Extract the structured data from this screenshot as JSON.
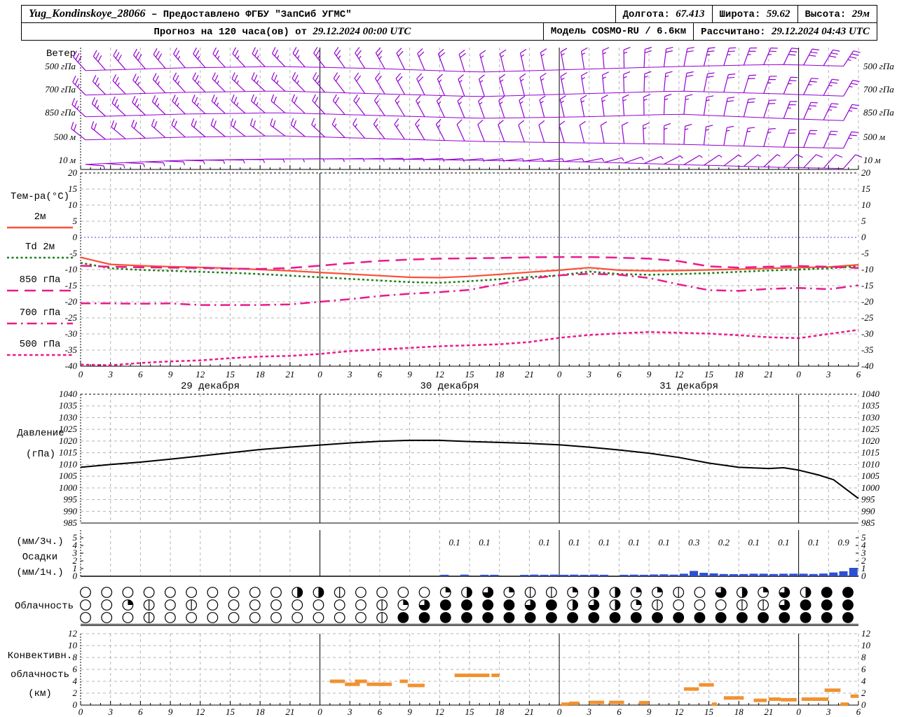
{
  "header": {
    "row1": {
      "station": "Yug_Kondinskoye_28066",
      "provider": "– Предоставлено ФГБУ \"ЗапСиб УГМС\"",
      "lon_label": "Долгота:",
      "lon_value": "67.413",
      "lat_label": "Широта:",
      "lat_value": "59.62",
      "alt_label": "Высота:",
      "alt_value": "29м"
    },
    "row2": {
      "forecast_label": "Прогноз на 120 часа(ов) от",
      "forecast_start": "29.12.2024 00:00 UTC",
      "model_label": "Модель",
      "model_value": "COSMO-RU / 6.6км",
      "calc_label": "Рассчитано:",
      "calc_value": "29.12.2024 04:43 UTC"
    }
  },
  "axes": {
    "hours": [
      0,
      3,
      6,
      9,
      12,
      15,
      18,
      21,
      24,
      27,
      30,
      33,
      36,
      39,
      42,
      45,
      48,
      51,
      54,
      57,
      60,
      63,
      66,
      69,
      72,
      75,
      78
    ],
    "date_labels": [
      {
        "hour": 13,
        "text": "29 декабря"
      },
      {
        "hour": 37,
        "text": "30 декабря"
      },
      {
        "hour": 61,
        "text": "31 декабря"
      }
    ]
  },
  "chart_data": [
    {
      "id": "wind",
      "type": "wind-barbs",
      "title": "Ветер",
      "color": "#9400d3",
      "control_hours": [
        0,
        10,
        20,
        30,
        40,
        50,
        60,
        70,
        78
      ],
      "rows": [
        {
          "label": "500 гПа",
          "dir": [
            318,
            320,
            315,
            330,
            345,
            350,
            370,
            385,
            395
          ],
          "spd": [
            30,
            30,
            28,
            25,
            20,
            18,
            22,
            30,
            35
          ],
          "dy": [
            6,
            2,
            0,
            3,
            8,
            4,
            0,
            -3,
            0
          ]
        },
        {
          "label": "700 гПа",
          "dir": [
            315,
            318,
            312,
            328,
            342,
            350,
            368,
            382,
            392
          ],
          "spd": [
            28,
            28,
            26,
            22,
            18,
            16,
            20,
            26,
            30
          ],
          "dy": [
            8,
            4,
            2,
            6,
            10,
            6,
            2,
            6,
            10
          ]
        },
        {
          "label": "850 гПа",
          "dir": [
            312,
            315,
            310,
            325,
            340,
            348,
            365,
            380,
            390
          ],
          "spd": [
            25,
            26,
            24,
            20,
            15,
            14,
            18,
            24,
            28
          ],
          "dy": [
            6,
            2,
            0,
            4,
            8,
            6,
            2,
            8,
            12
          ]
        },
        {
          "label": "500 м",
          "dir": [
            308,
            312,
            306,
            322,
            338,
            345,
            363,
            378,
            388
          ],
          "spd": [
            22,
            23,
            21,
            18,
            12,
            12,
            16,
            20,
            25
          ],
          "dy": [
            4,
            0,
            -2,
            2,
            6,
            8,
            10,
            14,
            16
          ]
        },
        {
          "label": "10 м",
          "dir": [
            95,
            92,
            90,
            88,
            85,
            80,
            60,
            45,
            40
          ],
          "spd": [
            8,
            9,
            9,
            8,
            7,
            6,
            8,
            10,
            12
          ],
          "dy": [
            6,
            0,
            -2,
            -2,
            0,
            2,
            6,
            10,
            12
          ]
        }
      ]
    },
    {
      "id": "temperature",
      "type": "line",
      "title": "Тем-ра(°C)",
      "ylim": [
        -40,
        20
      ],
      "ytick_step": 5,
      "zero_line_color": "#4040ff",
      "x_step_hours": 3,
      "series": [
        {
          "name": "2м",
          "color": "#fa5038",
          "style": "solid",
          "values": [
            -6.2,
            -8.4,
            -8.8,
            -9.1,
            -9.3,
            -9.6,
            -10.0,
            -10.4,
            -10.9,
            -11.4,
            -11.9,
            -12.4,
            -12.5,
            -12.1,
            -11.5,
            -10.8,
            -10.2,
            -9.4,
            -10.2,
            -10.4,
            -10.3,
            -10.1,
            -9.9,
            -9.6,
            -9.4,
            -9.2,
            -8.5
          ]
        },
        {
          "name": "Td 2м",
          "color": "#177d17",
          "style": "dotted",
          "values": [
            -7.9,
            -9.6,
            -10.1,
            -10.4,
            -10.7,
            -11.0,
            -11.4,
            -11.9,
            -12.4,
            -12.9,
            -13.4,
            -13.9,
            -14.1,
            -13.6,
            -13.0,
            -12.3,
            -11.8,
            -10.6,
            -11.4,
            -11.6,
            -11.4,
            -11.1,
            -10.7,
            -10.3,
            -10.0,
            -9.6,
            -9.0
          ]
        },
        {
          "name": "850 гПа",
          "color": "#ea1a8c",
          "style": "longdash",
          "values": [
            -8.8,
            -9.1,
            -9.3,
            -9.4,
            -9.5,
            -9.7,
            -9.8,
            -9.5,
            -8.8,
            -8.0,
            -7.3,
            -6.9,
            -6.6,
            -6.5,
            -6.4,
            -6.2,
            -6.1,
            -6.1,
            -6.3,
            -6.6,
            -7.4,
            -9.0,
            -9.4,
            -9.1,
            -8.9,
            -9.1,
            -9.5
          ]
        },
        {
          "name": "700 гПа",
          "color": "#ea1a8c",
          "style": "dashdot",
          "values": [
            -20.5,
            -20.5,
            -20.6,
            -20.5,
            -21.0,
            -21.0,
            -21.0,
            -20.8,
            -20.0,
            -19.2,
            -18.2,
            -17.5,
            -17.0,
            -16.3,
            -14.5,
            -12.8,
            -11.8,
            -11.3,
            -11.6,
            -12.6,
            -14.6,
            -16.4,
            -16.6,
            -16.0,
            -15.7,
            -16.1,
            -14.9
          ]
        },
        {
          "name": "500 гПа",
          "color": "#ea1a8c",
          "style": "shortdash",
          "values": [
            -39.5,
            -39.7,
            -39.0,
            -38.5,
            -38.2,
            -37.5,
            -37.0,
            -36.8,
            -36.2,
            -35.3,
            -34.8,
            -34.3,
            -33.8,
            -33.5,
            -33.2,
            -32.5,
            -31.2,
            -30.3,
            -29.8,
            -29.4,
            -29.6,
            -29.9,
            -30.4,
            -31.0,
            -31.3,
            -30.0,
            -28.7
          ]
        }
      ]
    },
    {
      "id": "pressure",
      "type": "line",
      "ylabel_lines": [
        "Давление",
        "(гПа)"
      ],
      "ylim": [
        985,
        1040
      ],
      "ytick_step": 5,
      "color": "#000000",
      "points": [
        [
          0,
          1008.8
        ],
        [
          3,
          1010.0
        ],
        [
          6,
          1011.0
        ],
        [
          9,
          1012.3
        ],
        [
          12,
          1013.6
        ],
        [
          15,
          1015.0
        ],
        [
          18,
          1016.4
        ],
        [
          21,
          1017.4
        ],
        [
          24,
          1018.3
        ],
        [
          27,
          1019.2
        ],
        [
          30,
          1019.9
        ],
        [
          33,
          1020.3
        ],
        [
          36,
          1020.3
        ],
        [
          39,
          1019.8
        ],
        [
          42,
          1019.4
        ],
        [
          45,
          1019.0
        ],
        [
          48,
          1018.4
        ],
        [
          51,
          1017.4
        ],
        [
          54,
          1016.2
        ],
        [
          57,
          1014.8
        ],
        [
          60,
          1013.0
        ],
        [
          63,
          1010.6
        ],
        [
          66,
          1008.8
        ],
        [
          69,
          1008.3
        ],
        [
          70.5,
          1008.6
        ],
        [
          72,
          1007.6
        ],
        [
          74,
          1005.5
        ],
        [
          75.5,
          1003.5
        ],
        [
          78,
          995.5
        ]
      ]
    },
    {
      "id": "precipitation",
      "type": "bar",
      "ylabel_lines": [
        "(мм/3ч.)",
        "Осадки",
        "(мм/1ч.)"
      ],
      "ylim": [
        0,
        5
      ],
      "bar_color": "#2d4fd2",
      "labels_3h": [
        {
          "h": 36,
          "v": "0.1"
        },
        {
          "h": 39,
          "v": "0.1"
        },
        {
          "h": 45,
          "v": "0.1"
        },
        {
          "h": 48,
          "v": "0.1"
        },
        {
          "h": 51,
          "v": "0.1"
        },
        {
          "h": 54,
          "v": "0.1"
        },
        {
          "h": 57,
          "v": "0.1"
        },
        {
          "h": 60,
          "v": "0.3"
        },
        {
          "h": 63,
          "v": "0.2"
        },
        {
          "h": 66,
          "v": "0.1"
        },
        {
          "h": 69,
          "v": "0.1"
        },
        {
          "h": 72,
          "v": "0.1"
        },
        {
          "h": 75,
          "v": "0.9"
        }
      ],
      "bars_1h": [
        [
          36,
          0.05
        ],
        [
          38,
          0.06
        ],
        [
          40,
          0.05
        ],
        [
          41,
          0.05
        ],
        [
          44,
          0.04
        ],
        [
          45,
          0.06
        ],
        [
          46,
          0.05
        ],
        [
          47,
          0.06
        ],
        [
          48,
          0.05
        ],
        [
          49,
          0.06
        ],
        [
          50,
          0.05
        ],
        [
          51,
          0.06
        ],
        [
          52,
          0.05
        ],
        [
          54,
          0.05
        ],
        [
          55,
          0.06
        ],
        [
          56,
          0.05
        ],
        [
          57,
          0.07
        ],
        [
          58,
          0.08
        ],
        [
          59,
          0.06
        ],
        [
          60,
          0.12
        ],
        [
          61,
          0.3
        ],
        [
          62,
          0.18
        ],
        [
          63,
          0.14
        ],
        [
          64,
          0.1
        ],
        [
          65,
          0.09
        ],
        [
          66,
          0.1
        ],
        [
          67,
          0.12
        ],
        [
          68,
          0.12
        ],
        [
          69,
          0.1
        ],
        [
          70,
          0.12
        ],
        [
          71,
          0.12
        ],
        [
          72,
          0.12
        ],
        [
          73,
          0.1
        ],
        [
          74,
          0.13
        ],
        [
          75,
          0.2
        ],
        [
          76,
          0.28
        ],
        [
          77,
          0.5
        ]
      ]
    },
    {
      "id": "cloudiness",
      "type": "cloud-cover",
      "label": "Облачность",
      "octa_rows": [
        [
          0,
          0,
          0,
          0,
          0,
          0,
          0,
          0,
          0,
          0,
          4,
          4,
          1,
          0,
          0,
          0,
          0,
          2,
          4,
          6,
          2,
          1,
          1,
          2,
          4,
          4,
          2,
          2,
          1,
          0,
          6,
          4,
          2,
          6,
          4,
          8,
          8
        ],
        [
          0,
          0,
          2,
          1,
          0,
          1,
          0,
          0,
          0,
          0,
          0,
          0,
          0,
          0,
          1,
          2,
          6,
          8,
          8,
          8,
          8,
          6,
          8,
          4,
          6,
          4,
          2,
          1,
          0,
          0,
          0,
          1,
          1,
          6,
          8,
          8,
          8
        ],
        [
          0,
          0,
          0,
          1,
          0,
          0,
          0,
          0,
          0,
          0,
          0,
          0,
          0,
          0,
          1,
          8,
          8,
          8,
          8,
          8,
          8,
          8,
          8,
          8,
          8,
          8,
          8,
          8,
          8,
          8,
          8,
          8,
          8,
          8,
          8,
          8,
          8
        ]
      ]
    },
    {
      "id": "convective",
      "type": "segments",
      "ylabel_lines": [
        "Конвективн.",
        "облачность",
        "(км)"
      ],
      "ylim": [
        0,
        12
      ],
      "ytick_step": 2,
      "color": "#f09231",
      "segments": [
        [
          25,
          26.5,
          4
        ],
        [
          26.5,
          28,
          3.5
        ],
        [
          27.5,
          28.7,
          4
        ],
        [
          28.7,
          30.5,
          3.5
        ],
        [
          30.2,
          31.2,
          3.5
        ],
        [
          32,
          32.8,
          4
        ],
        [
          32.8,
          34.5,
          3.3
        ],
        [
          37.5,
          41,
          5
        ],
        [
          41.2,
          42,
          5
        ],
        [
          48.2,
          49,
          0.15
        ],
        [
          49,
          50,
          0.3
        ],
        [
          51,
          52.5,
          0.45
        ],
        [
          53,
          54.5,
          0.45
        ],
        [
          56,
          57,
          0.4
        ],
        [
          60.5,
          62,
          2.7
        ],
        [
          62,
          63.5,
          3.4
        ],
        [
          63.3,
          63.8,
          0.15
        ],
        [
          64.5,
          66.5,
          1.2
        ],
        [
          67.5,
          68.8,
          0.8
        ],
        [
          69,
          70.2,
          1.0
        ],
        [
          70.2,
          71.8,
          0.9
        ],
        [
          72.3,
          75,
          1.0
        ],
        [
          74.6,
          76.2,
          2.5
        ],
        [
          76.2,
          77,
          0.15
        ],
        [
          77.2,
          78,
          1.5
        ]
      ]
    }
  ]
}
